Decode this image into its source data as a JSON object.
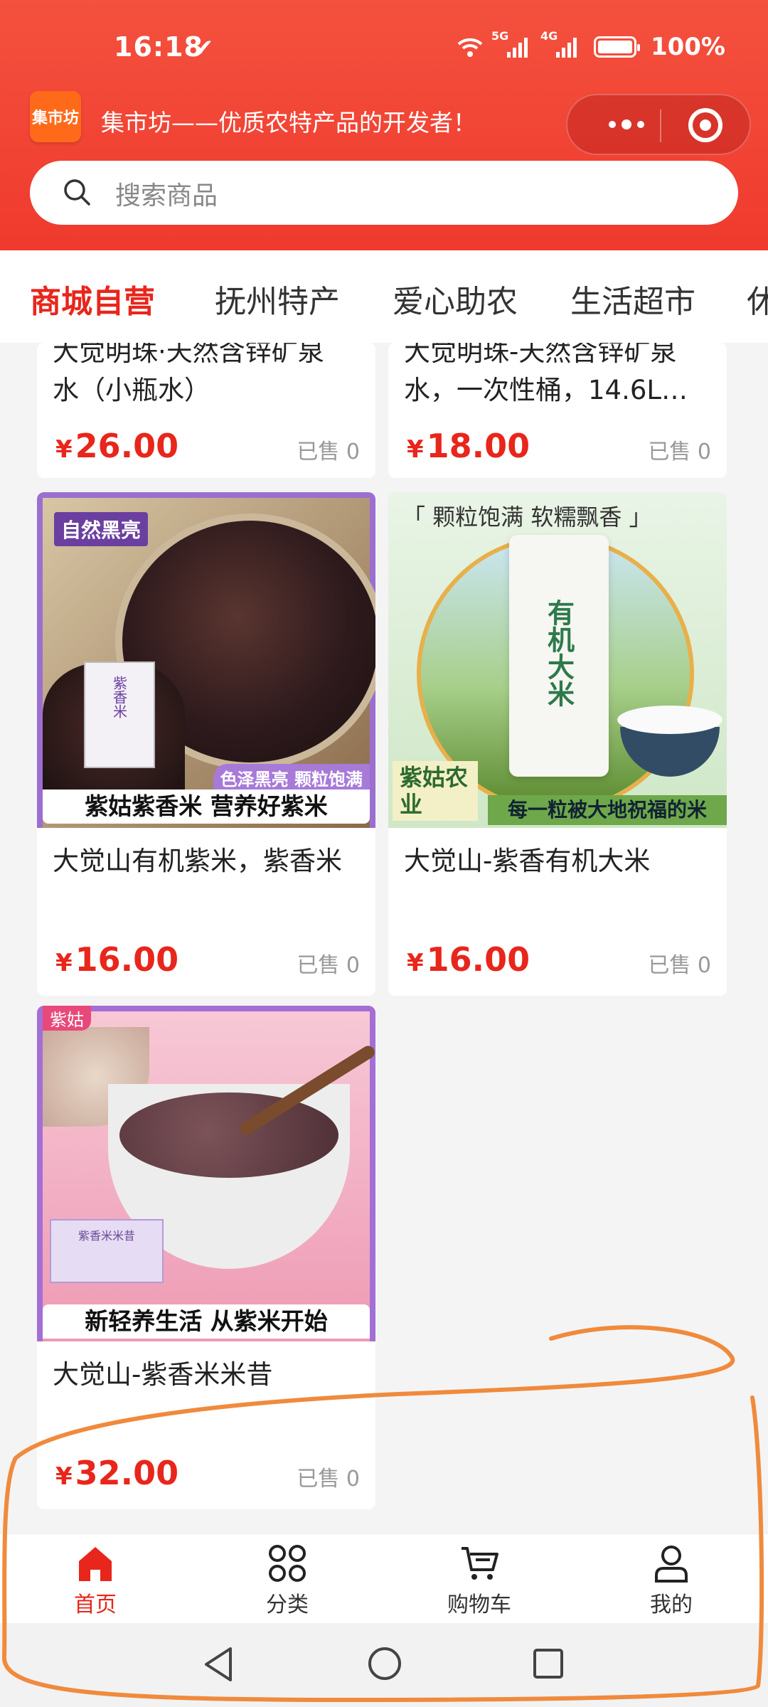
{
  "status_bar": {
    "time": "16:18",
    "net1": "5G",
    "net2": "4G",
    "battery": "100%"
  },
  "header": {
    "logo_text": "集市坊",
    "slogan": "集市坊——优质农特产品的开发者！",
    "search_placeholder": "搜索商品"
  },
  "tabs": [
    {
      "label": "商城自营",
      "active": true
    },
    {
      "label": "抚州特产"
    },
    {
      "label": "爱心助农"
    },
    {
      "label": "生活超市"
    },
    {
      "label": "休"
    }
  ],
  "products": [
    {
      "title": "大觉明珠·天然含锌矿泉水（小瓶水）",
      "title_lines": [
        "大觉明珠·天然含锌矿泉",
        "水（小瓶水）"
      ],
      "price": "26.00",
      "currency": "¥",
      "sold": "已售 0"
    },
    {
      "title": "大觉明珠-天然含锌矿泉水，一次性桶，14.6L…",
      "title_lines": [
        "大觉明珠-天然含锌矿泉",
        "水，一次性桶，14.6L…"
      ],
      "price": "18.00",
      "currency": "¥",
      "sold": "已售 0"
    },
    {
      "title": "大觉山有机紫米，紫香米",
      "price": "16.00",
      "currency": "¥",
      "sold": "已售 0",
      "image": {
        "badge": "自然黑亮",
        "tag": "色泽黑亮 颗粒饱满",
        "bag_text": "紫香米",
        "banner": "紫姑紫香米 营养好紫米"
      }
    },
    {
      "title": "大觉山-紫香有机大米",
      "price": "16.00",
      "currency": "¥",
      "sold": "已售 0",
      "image": {
        "headline": "「 颗粒饱满 软糯飘香 」",
        "bag_text": "有机大米",
        "brand": "紫姑农业",
        "banner": "每一粒被大地祝福的米"
      }
    },
    {
      "title": "大觉山-紫香米米昔",
      "price": "32.00",
      "currency": "¥",
      "sold": "已售 0",
      "image": {
        "corner": "紫姑",
        "box_text": "紫香米米昔",
        "banner": "新轻养生活  从紫米开始"
      }
    }
  ],
  "bottom_nav": [
    {
      "label": "首页",
      "icon": "home-icon",
      "active": true
    },
    {
      "label": "分类",
      "icon": "grid-icon"
    },
    {
      "label": "购物车",
      "icon": "cart-icon"
    },
    {
      "label": "我的",
      "icon": "user-icon"
    }
  ],
  "system_nav": [
    "back-icon",
    "home-circle-icon",
    "recents-icon"
  ],
  "colors": {
    "brand_red": "#ef3a2d",
    "price_red": "#e8261c",
    "annotation_orange": "#f08a3c"
  }
}
